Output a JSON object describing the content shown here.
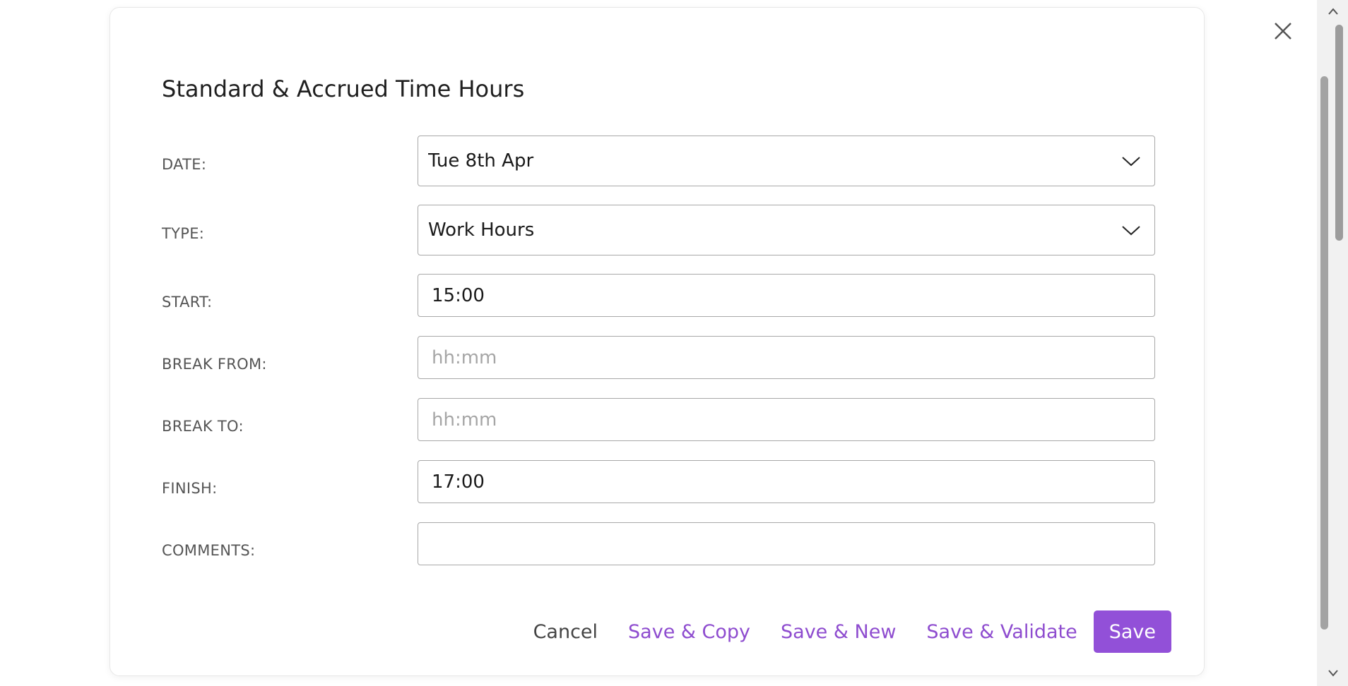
{
  "modal": {
    "title": "Standard & Accrued Time Hours",
    "fields": {
      "date": {
        "label": "DATE:",
        "value": "Tue 8th Apr"
      },
      "type": {
        "label": "TYPE:",
        "value": "Work Hours"
      },
      "start": {
        "label": "START:",
        "value": "15:00"
      },
      "break_from": {
        "label": "BREAK FROM:",
        "placeholder": "hh:mm"
      },
      "break_to": {
        "label": "BREAK TO:",
        "placeholder": "hh:mm"
      },
      "finish": {
        "label": "FINISH:",
        "value": "17:00"
      },
      "comments": {
        "label": "COMMENTS:",
        "value": ""
      }
    },
    "footer": {
      "cancel_label": "Cancel",
      "save_copy_label": "Save & Copy",
      "save_new_label": "Save & New",
      "save_validate_label": "Save & Validate",
      "save_label": "Save"
    }
  },
  "icons": {
    "close": "close-icon",
    "chevron": "chevron-down-icon"
  },
  "colors": {
    "accent": "#9250d8",
    "link": "#8e4ccf",
    "border": "#a8a8a8",
    "placeholder": "#a6a6a6"
  }
}
